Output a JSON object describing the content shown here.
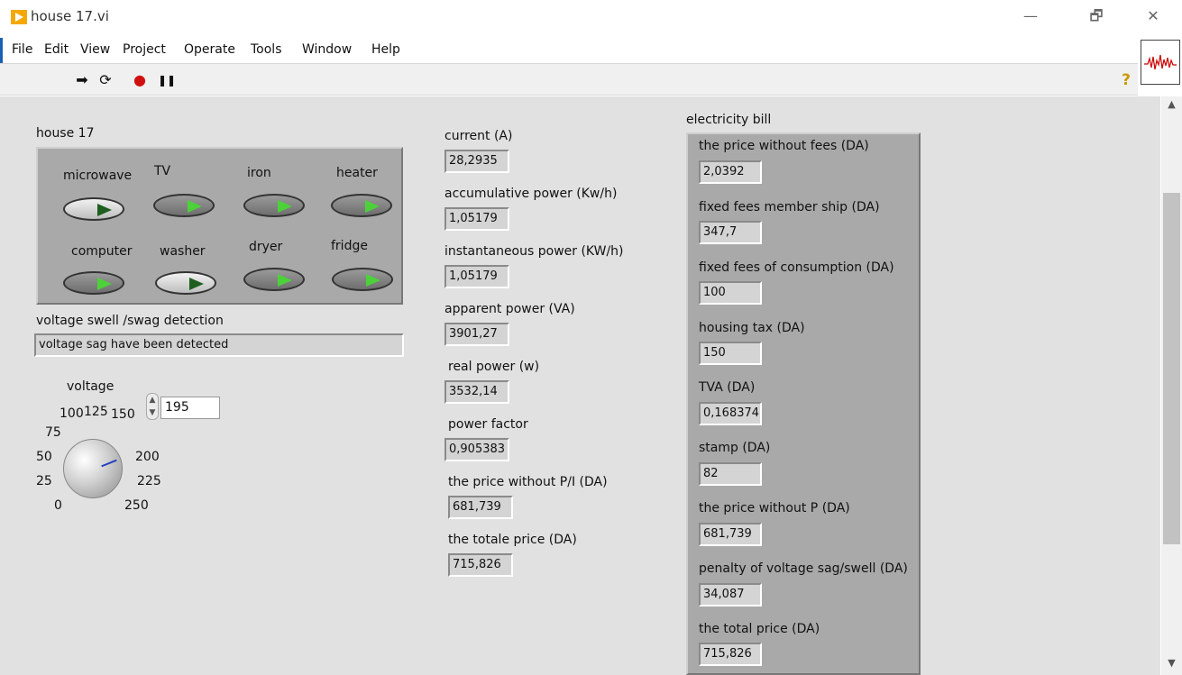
{
  "window": {
    "title": "house 17.vi",
    "minimize": "—",
    "restore": "🗗",
    "close": "✕"
  },
  "menu": [
    "File",
    "Edit",
    "View",
    "Project",
    "Operate",
    "Tools",
    "Window",
    "Help"
  ],
  "toolbar": {
    "run": "➡",
    "run_continuous": "⟳",
    "abort": "●",
    "pause": "❚❚",
    "help": "?"
  },
  "house": {
    "label": "house 17",
    "switches": [
      {
        "label": "microwave",
        "on": false
      },
      {
        "label": "TV",
        "on": true
      },
      {
        "label": "iron",
        "on": true
      },
      {
        "label": "heater",
        "on": true
      },
      {
        "label": "computer",
        "on": true
      },
      {
        "label": "washer",
        "on": false
      },
      {
        "label": "dryer",
        "on": true
      },
      {
        "label": "fridge",
        "on": true
      }
    ]
  },
  "detection": {
    "label": "voltage swell /swag detection",
    "message": "voltage sag have been detected"
  },
  "voltage": {
    "label": "voltage",
    "value": "195",
    "ticks": [
      "0",
      "25",
      "50",
      "75",
      "100",
      "125",
      "150",
      "200",
      "225",
      "250"
    ]
  },
  "measurements": [
    {
      "label": "current (A)",
      "value": "28,2935"
    },
    {
      "label": "accumulative power (Kw/h)",
      "value": "1,05179"
    },
    {
      "label": "instantaneous power (KW/h)",
      "value": "1,05179"
    },
    {
      "label": "apparent power (VA)",
      "value": "3901,27"
    },
    {
      "label": "real power (w)",
      "value": "3532,14"
    },
    {
      "label": "power factor",
      "value": "0,905383"
    },
    {
      "label": "the price without P/I (DA)",
      "value": "681,739"
    },
    {
      "label": "the totale price (DA)",
      "value": "715,826"
    }
  ],
  "bill": {
    "title": "electricity bill",
    "items": [
      {
        "label": "the price without fees  (DA)",
        "value": "2,0392"
      },
      {
        "label": "fixed fees member ship (DA)",
        "value": "347,7"
      },
      {
        "label": "fixed fees of consumption (DA)",
        "value": "100"
      },
      {
        "label": "housing tax (DA)",
        "value": "150"
      },
      {
        "label": " TVA (DA)",
        "value": "0,168374"
      },
      {
        "label": "stamp (DA)",
        "value": "82"
      },
      {
        "label": "the price without P (DA)",
        "value": "681,739"
      },
      {
        "label": "penalty of voltage sag/swell  (DA)",
        "value": "34,087"
      },
      {
        "label": "the total price (DA)",
        "value": "715,826"
      }
    ]
  },
  "colors": {
    "panel": "#e1e1e1",
    "cluster": "#a9a9a9",
    "led_on": "#4cd13a",
    "led_off": "#1f5e1f",
    "accent": "#f5a800"
  }
}
